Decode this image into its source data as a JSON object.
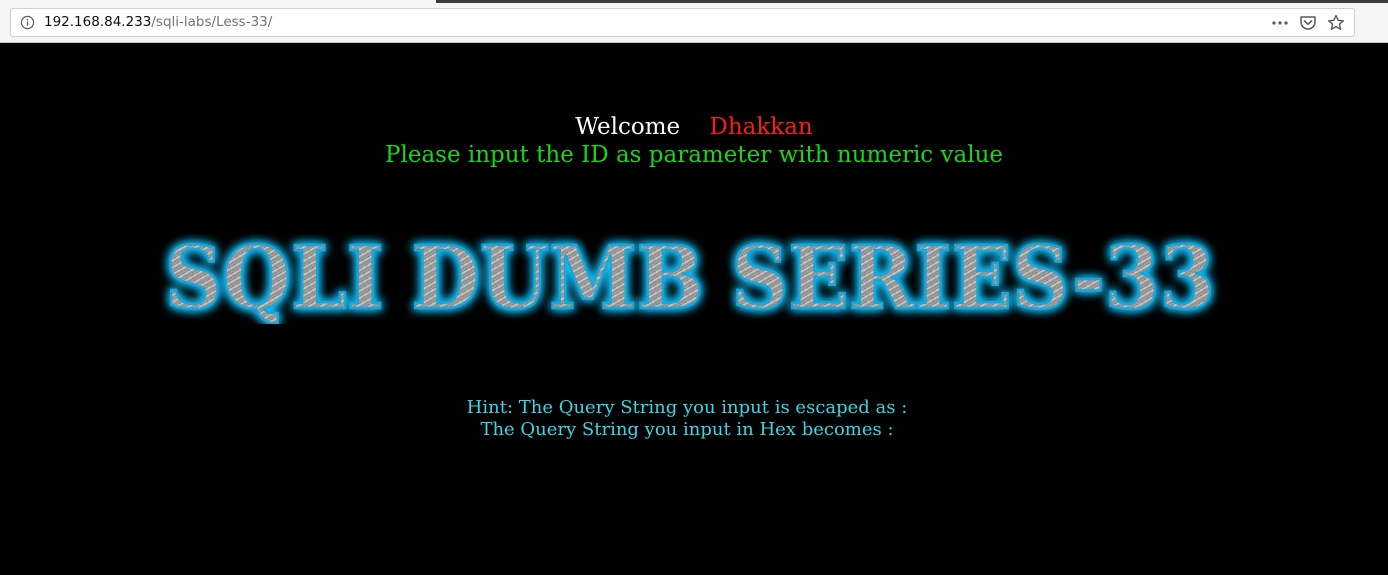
{
  "browser": {
    "url_host": "192.168.84.233",
    "url_path": "/sqli-labs/Less-33/",
    "icons": [
      "info-icon",
      "more-actions-icon",
      "pocket-icon",
      "bookmark-star-icon"
    ]
  },
  "page": {
    "welcome_label": "Welcome",
    "welcome_user": "Dhakkan",
    "instruction": "Please input the ID as parameter with numeric value",
    "banner_text": "SQLI DUMB SERIES-33",
    "hint_escaped": "Hint: The Query String you input is escaped as : ",
    "hint_hex": "The Query String you input in Hex becomes : "
  },
  "colors": {
    "background": "#000000",
    "welcome_label": "#ffffff",
    "welcome_user": "#ff1a1a",
    "instruction": "#17d817",
    "hint": "#37d7e6",
    "banner_glow": "#19c3ff"
  }
}
